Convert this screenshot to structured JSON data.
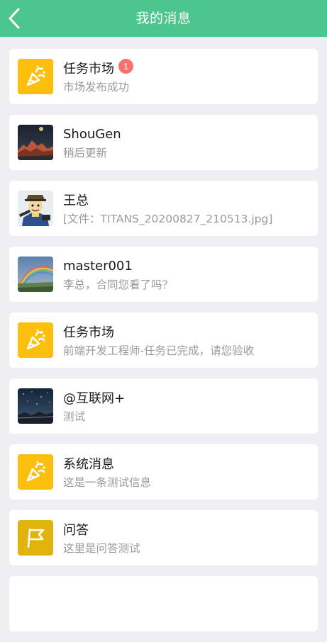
{
  "header": {
    "title": "我的消息"
  },
  "messages": [
    {
      "name": "任务市场",
      "preview": "市场发布成功",
      "badge": "1",
      "avatar": "party-popper-icon"
    },
    {
      "name": "ShouGen",
      "preview": "稍后更新",
      "avatar": "mountain-photo"
    },
    {
      "name": "王总",
      "preview": "[文件：TITANS_20200827_210513.jpg]",
      "avatar": "cartoon-character"
    },
    {
      "name": "master001",
      "preview": "李总，合同您看了吗？",
      "avatar": "rainbow-photo"
    },
    {
      "name": "任务市场",
      "preview": "前端开发工程师-任务已完成，请您验收",
      "avatar": "party-popper-icon"
    },
    {
      "name": "@互联网+",
      "preview": "测试",
      "avatar": "night-sky-photo"
    },
    {
      "name": "系统消息",
      "preview": "这是一条测试信息",
      "avatar": "party-popper-icon"
    },
    {
      "name": "问答",
      "preview": "这里是问答测试",
      "avatar": "flag-icon"
    }
  ],
  "colors": {
    "header": "#4cc68d",
    "page_bg": "#eeeef3",
    "badge": "#f87171",
    "system_icon_bg": "#fcbf0d",
    "qa_icon_bg": "#e0b40d"
  }
}
